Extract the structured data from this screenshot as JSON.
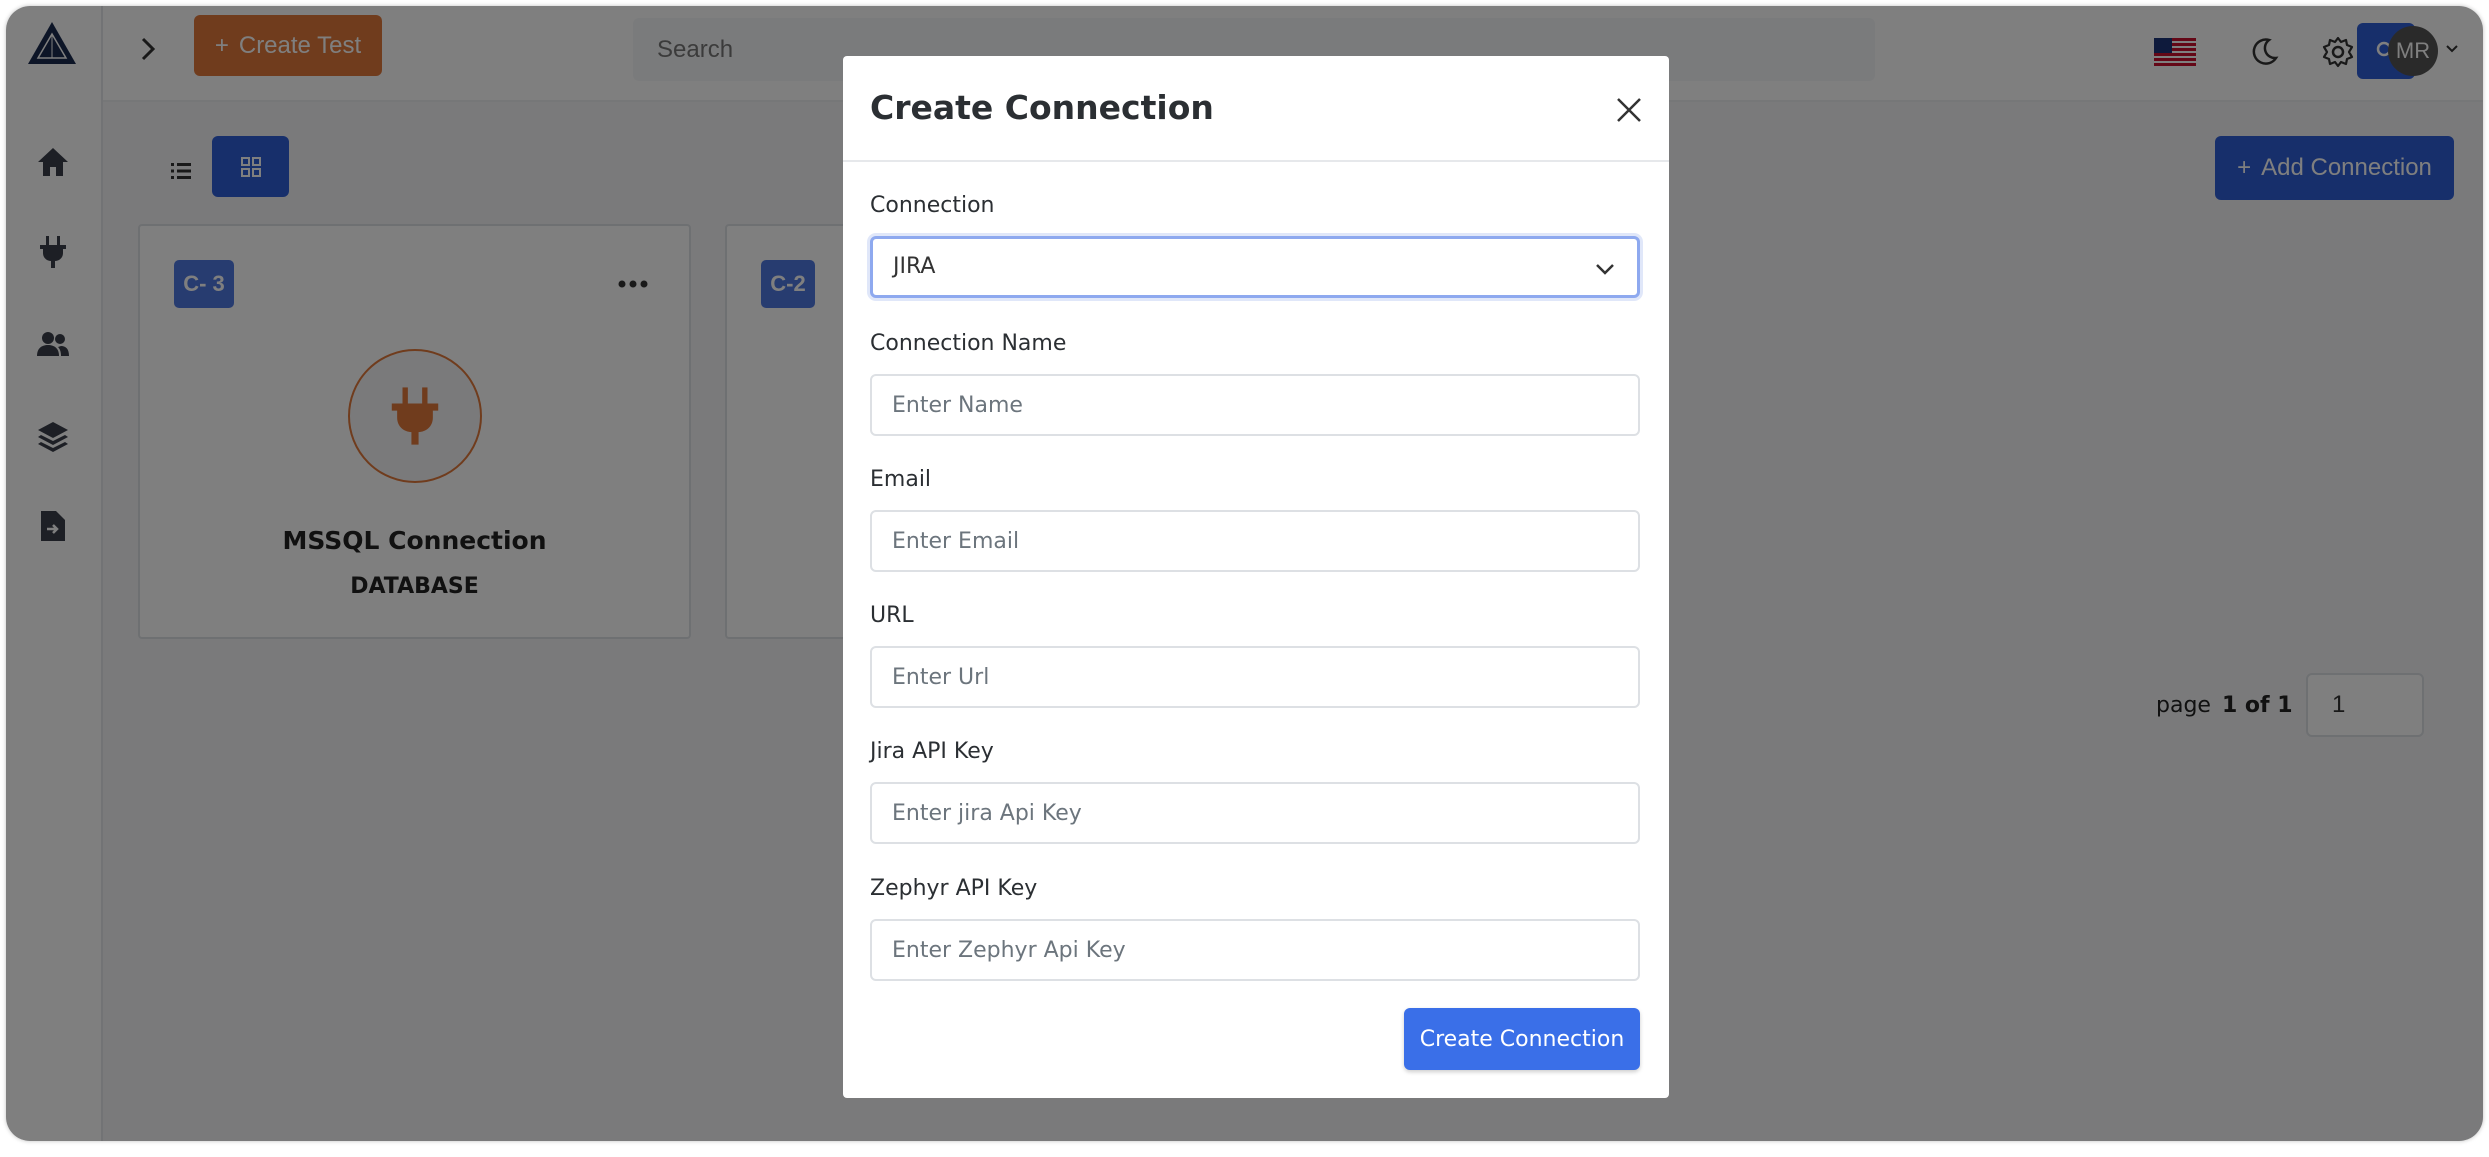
{
  "topbar": {
    "create_test_label": "Create Test",
    "search_placeholder": "Search",
    "avatar_initials": "MR"
  },
  "toolbar": {
    "add_connection_label": "Add Connection"
  },
  "cards": [
    {
      "badge": "C- 3",
      "title": "MSSQL Connection",
      "type": "DATABASE"
    },
    {
      "badge": "C-2"
    }
  ],
  "pagination": {
    "prefix": "page",
    "current_text": "1 of 1",
    "page_value": "1"
  },
  "modal": {
    "title": "Create Connection",
    "connection_label": "Connection",
    "connection_value": "JIRA",
    "name_label": "Connection Name",
    "name_placeholder": "Enter Name",
    "email_label": "Email",
    "email_placeholder": "Enter Email",
    "url_label": "URL",
    "url_placeholder": "Enter Url",
    "jira_key_label": "Jira API Key",
    "jira_key_placeholder": "Enter jira Api Key",
    "zephyr_key_label": "Zephyr API Key",
    "zephyr_key_placeholder": "Enter Zephyr Api Key",
    "submit_label": "Create Connection"
  },
  "colors": {
    "primary": "#2f5fd6",
    "accent_orange": "#e1793b",
    "badge_blue": "#4f78e0",
    "submit_blue": "#3a6fe8"
  }
}
